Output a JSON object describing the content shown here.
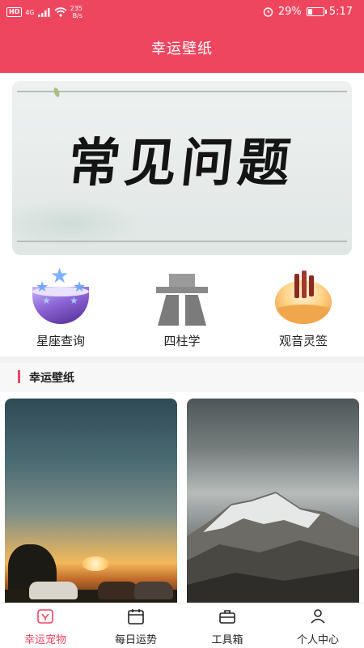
{
  "status_bar": {
    "hd": "HD",
    "network": "4G",
    "speed_value": "235",
    "speed_unit": "B/s",
    "battery_percent": "29%",
    "time": "5:17",
    "battery_level": 0.29,
    "icons": [
      "signal-icon",
      "wifi-icon",
      "alarm-icon",
      "battery-icon"
    ]
  },
  "header": {
    "title": "幸运壁纸"
  },
  "banner": {
    "text": "常见问题"
  },
  "quick_menu": [
    {
      "label": "星座查询",
      "icon": "constellation-icon"
    },
    {
      "label": "四柱学",
      "icon": "road-icon"
    },
    {
      "label": "观音灵签",
      "icon": "fortune-sticks-icon"
    }
  ],
  "section": {
    "title": "幸运壁纸"
  },
  "wallpapers": [
    {
      "name": "sunset-horses-wallpaper"
    },
    {
      "name": "snowy-mountain-wallpaper"
    }
  ],
  "tabbar": {
    "tabs": [
      {
        "label": "幸运宠物",
        "icon": "pet-icon",
        "active": true
      },
      {
        "label": "每日运势",
        "icon": "calendar-icon",
        "active": false
      },
      {
        "label": "工具箱",
        "icon": "toolbox-icon",
        "active": false
      },
      {
        "label": "个人中心",
        "icon": "user-icon",
        "active": false
      }
    ]
  },
  "colors": {
    "accent": "#ef4660",
    "text": "#222222",
    "section_bg": "#f7f7f7"
  }
}
